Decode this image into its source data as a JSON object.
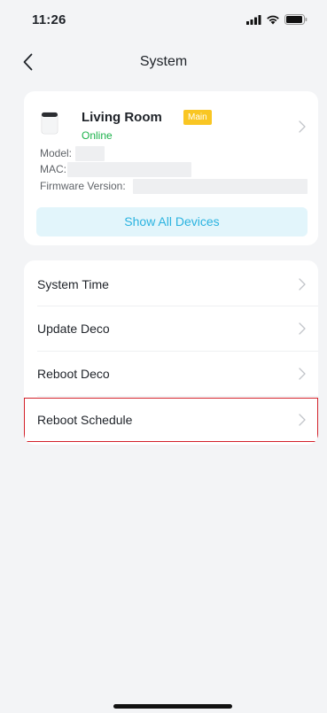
{
  "status_bar": {
    "time": "11:26",
    "icons": [
      "signal-icon",
      "wifi-icon",
      "battery-icon"
    ]
  },
  "nav": {
    "title": "System",
    "back_icon": "chevron-left-icon"
  },
  "device": {
    "name": "Living Room",
    "badge": "Main",
    "status": "Online",
    "model_label": "Model:",
    "mac_label": "MAC:",
    "firmware_label": "Firmware Version:",
    "show_all_label": "Show All Devices"
  },
  "menu": {
    "items": [
      {
        "label": "System Time"
      },
      {
        "label": "Update Deco"
      },
      {
        "label": "Reboot Deco"
      },
      {
        "label": "Reboot Schedule"
      }
    ]
  },
  "colors": {
    "online": "#1cb24b",
    "badge": "#f9c623",
    "accent": "#2bb3e0",
    "highlight": "#d32029"
  }
}
